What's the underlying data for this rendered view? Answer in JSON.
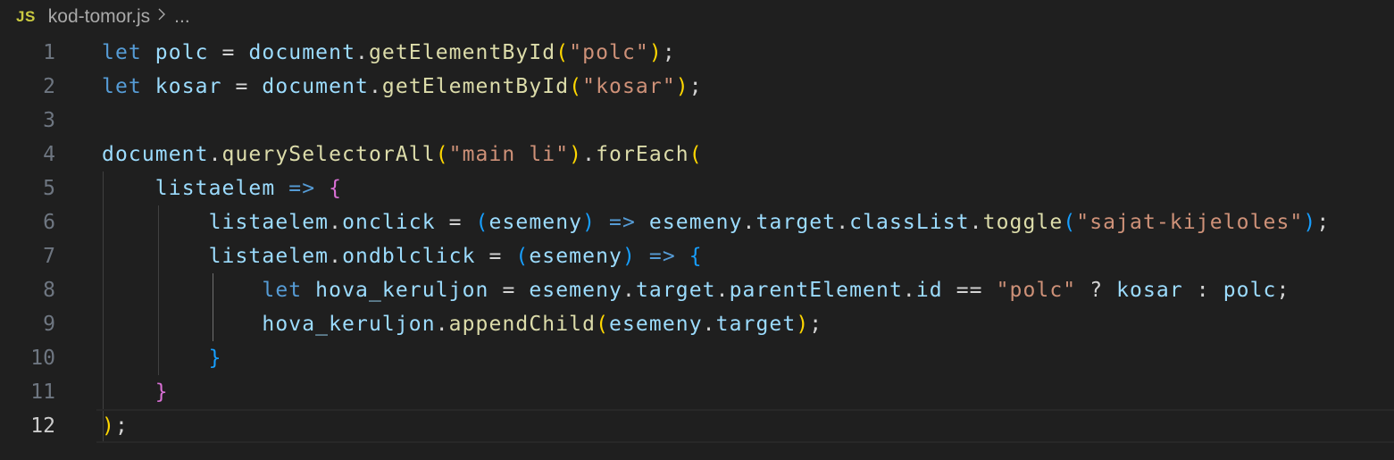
{
  "breadcrumb": {
    "language_badge": "JS",
    "file_name": "kod-tomor.js",
    "separator_icon": "chevron-right-icon",
    "ellipsis": "..."
  },
  "editor": {
    "current_line": 12,
    "lines": [
      {
        "number": "1",
        "tokens": [
          {
            "t": "let",
            "c": "kw"
          },
          {
            "t": " ",
            "c": "plain"
          },
          {
            "t": "polc",
            "c": "var"
          },
          {
            "t": " = ",
            "c": "op"
          },
          {
            "t": "document",
            "c": "var"
          },
          {
            "t": ".",
            "c": "plain"
          },
          {
            "t": "getElementById",
            "c": "fn"
          },
          {
            "t": "(",
            "c": "p1"
          },
          {
            "t": "\"polc\"",
            "c": "str"
          },
          {
            "t": ")",
            "c": "p1"
          },
          {
            "t": ";",
            "c": "plain"
          }
        ]
      },
      {
        "number": "2",
        "tokens": [
          {
            "t": "let",
            "c": "kw"
          },
          {
            "t": " ",
            "c": "plain"
          },
          {
            "t": "kosar",
            "c": "var"
          },
          {
            "t": " = ",
            "c": "op"
          },
          {
            "t": "document",
            "c": "var"
          },
          {
            "t": ".",
            "c": "plain"
          },
          {
            "t": "getElementById",
            "c": "fn"
          },
          {
            "t": "(",
            "c": "p1"
          },
          {
            "t": "\"kosar\"",
            "c": "str"
          },
          {
            "t": ")",
            "c": "p1"
          },
          {
            "t": ";",
            "c": "plain"
          }
        ]
      },
      {
        "number": "3",
        "tokens": []
      },
      {
        "number": "4",
        "tokens": [
          {
            "t": "document",
            "c": "var"
          },
          {
            "t": ".",
            "c": "plain"
          },
          {
            "t": "querySelectorAll",
            "c": "fn"
          },
          {
            "t": "(",
            "c": "p1"
          },
          {
            "t": "\"main li\"",
            "c": "str"
          },
          {
            "t": ")",
            "c": "p1"
          },
          {
            "t": ".",
            "c": "plain"
          },
          {
            "t": "forEach",
            "c": "fn"
          },
          {
            "t": "(",
            "c": "p1"
          }
        ]
      },
      {
        "number": "5",
        "tokens": [
          {
            "t": "    ",
            "c": "plain"
          },
          {
            "t": "listaelem",
            "c": "var"
          },
          {
            "t": " ",
            "c": "plain"
          },
          {
            "t": "=>",
            "c": "kw"
          },
          {
            "t": " ",
            "c": "plain"
          },
          {
            "t": "{",
            "c": "p2"
          }
        ]
      },
      {
        "number": "6",
        "tokens": [
          {
            "t": "        ",
            "c": "plain"
          },
          {
            "t": "listaelem",
            "c": "var"
          },
          {
            "t": ".",
            "c": "plain"
          },
          {
            "t": "onclick",
            "c": "var"
          },
          {
            "t": " = ",
            "c": "op"
          },
          {
            "t": "(",
            "c": "p3"
          },
          {
            "t": "esemeny",
            "c": "var"
          },
          {
            "t": ")",
            "c": "p3"
          },
          {
            "t": " ",
            "c": "plain"
          },
          {
            "t": "=>",
            "c": "kw"
          },
          {
            "t": " ",
            "c": "plain"
          },
          {
            "t": "esemeny",
            "c": "var"
          },
          {
            "t": ".",
            "c": "plain"
          },
          {
            "t": "target",
            "c": "var"
          },
          {
            "t": ".",
            "c": "plain"
          },
          {
            "t": "classList",
            "c": "var"
          },
          {
            "t": ".",
            "c": "plain"
          },
          {
            "t": "toggle",
            "c": "fn"
          },
          {
            "t": "(",
            "c": "p3"
          },
          {
            "t": "\"sajat-kijeloles\"",
            "c": "str"
          },
          {
            "t": ")",
            "c": "p3"
          },
          {
            "t": ";",
            "c": "plain"
          }
        ]
      },
      {
        "number": "7",
        "tokens": [
          {
            "t": "        ",
            "c": "plain"
          },
          {
            "t": "listaelem",
            "c": "var"
          },
          {
            "t": ".",
            "c": "plain"
          },
          {
            "t": "ondblclick",
            "c": "var"
          },
          {
            "t": " = ",
            "c": "op"
          },
          {
            "t": "(",
            "c": "p3"
          },
          {
            "t": "esemeny",
            "c": "var"
          },
          {
            "t": ")",
            "c": "p3"
          },
          {
            "t": " ",
            "c": "plain"
          },
          {
            "t": "=>",
            "c": "kw"
          },
          {
            "t": " ",
            "c": "plain"
          },
          {
            "t": "{",
            "c": "p3"
          }
        ]
      },
      {
        "number": "8",
        "tokens": [
          {
            "t": "            ",
            "c": "plain"
          },
          {
            "t": "let",
            "c": "kw"
          },
          {
            "t": " ",
            "c": "plain"
          },
          {
            "t": "hova_keruljon",
            "c": "var"
          },
          {
            "t": " = ",
            "c": "op"
          },
          {
            "t": "esemeny",
            "c": "var"
          },
          {
            "t": ".",
            "c": "plain"
          },
          {
            "t": "target",
            "c": "var"
          },
          {
            "t": ".",
            "c": "plain"
          },
          {
            "t": "parentElement",
            "c": "var"
          },
          {
            "t": ".",
            "c": "plain"
          },
          {
            "t": "id",
            "c": "var"
          },
          {
            "t": " == ",
            "c": "op"
          },
          {
            "t": "\"polc\"",
            "c": "str"
          },
          {
            "t": " ? ",
            "c": "op"
          },
          {
            "t": "kosar",
            "c": "var"
          },
          {
            "t": " : ",
            "c": "op"
          },
          {
            "t": "polc",
            "c": "var"
          },
          {
            "t": ";",
            "c": "plain"
          }
        ]
      },
      {
        "number": "9",
        "tokens": [
          {
            "t": "            ",
            "c": "plain"
          },
          {
            "t": "hova_keruljon",
            "c": "var"
          },
          {
            "t": ".",
            "c": "plain"
          },
          {
            "t": "appendChild",
            "c": "fn"
          },
          {
            "t": "(",
            "c": "p1"
          },
          {
            "t": "esemeny",
            "c": "var"
          },
          {
            "t": ".",
            "c": "plain"
          },
          {
            "t": "target",
            "c": "var"
          },
          {
            "t": ")",
            "c": "p1"
          },
          {
            "t": ";",
            "c": "plain"
          }
        ]
      },
      {
        "number": "10",
        "tokens": [
          {
            "t": "        ",
            "c": "plain"
          },
          {
            "t": "}",
            "c": "p3"
          }
        ]
      },
      {
        "number": "11",
        "tokens": [
          {
            "t": "    ",
            "c": "plain"
          },
          {
            "t": "}",
            "c": "p2"
          }
        ]
      },
      {
        "number": "12",
        "tokens": [
          {
            "t": ")",
            "c": "p1"
          },
          {
            "t": ";",
            "c": "plain"
          }
        ]
      }
    ]
  },
  "colors": {
    "background": "#1f1f1f",
    "keyword": "#569cd6",
    "variable": "#9cdcfe",
    "function": "#dcdcaa",
    "string": "#ce9178",
    "bracket_level_1": "#ffd700",
    "bracket_level_2": "#da70d6",
    "bracket_level_3": "#179fff",
    "line_number": "#6e7681",
    "js_badge": "#cbcb41"
  }
}
